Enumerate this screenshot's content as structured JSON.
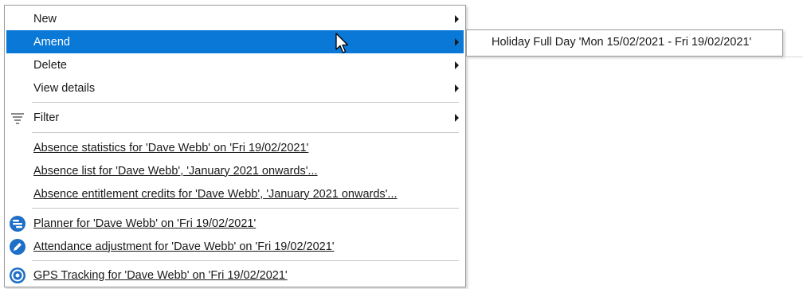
{
  "context_menu": {
    "new_label": "New",
    "amend_label": "Amend",
    "delete_label": "Delete",
    "view_details_label": "View details",
    "filter_label": "Filter",
    "absence_statistics_label": "Absence statistics for 'Dave Webb' on 'Fri 19/02/2021'",
    "absence_list_label": "Absence list for 'Dave Webb', 'January 2021 onwards'...",
    "absence_entitlement_label": "Absence entitlement credits for 'Dave Webb', 'January 2021 onwards'...",
    "planner_label": "Planner for 'Dave Webb' on 'Fri 19/02/2021'",
    "attendance_adjustment_label": "Attendance adjustment for 'Dave Webb' on 'Fri 19/02/2021'",
    "gps_tracking_label": "GPS Tracking for 'Dave Webb' on 'Fri 19/02/2021'"
  },
  "amend_submenu": {
    "holiday_item_label": "Holiday Full Day 'Mon 15/02/2021 - Fri 19/02/2021'"
  },
  "colors": {
    "selection": "#0a78d7",
    "planner_icon": "#1e6fc8",
    "attendance_icon": "#1e6fc8",
    "gps_icon": "#1e6fc8"
  },
  "icons": {
    "filter": "funnel-icon",
    "planner": "planner-icon",
    "attendance": "pencil-circle-icon",
    "gps": "target-icon",
    "submenu": "chevron-right-icon",
    "pointer": "mouse-cursor-icon"
  }
}
